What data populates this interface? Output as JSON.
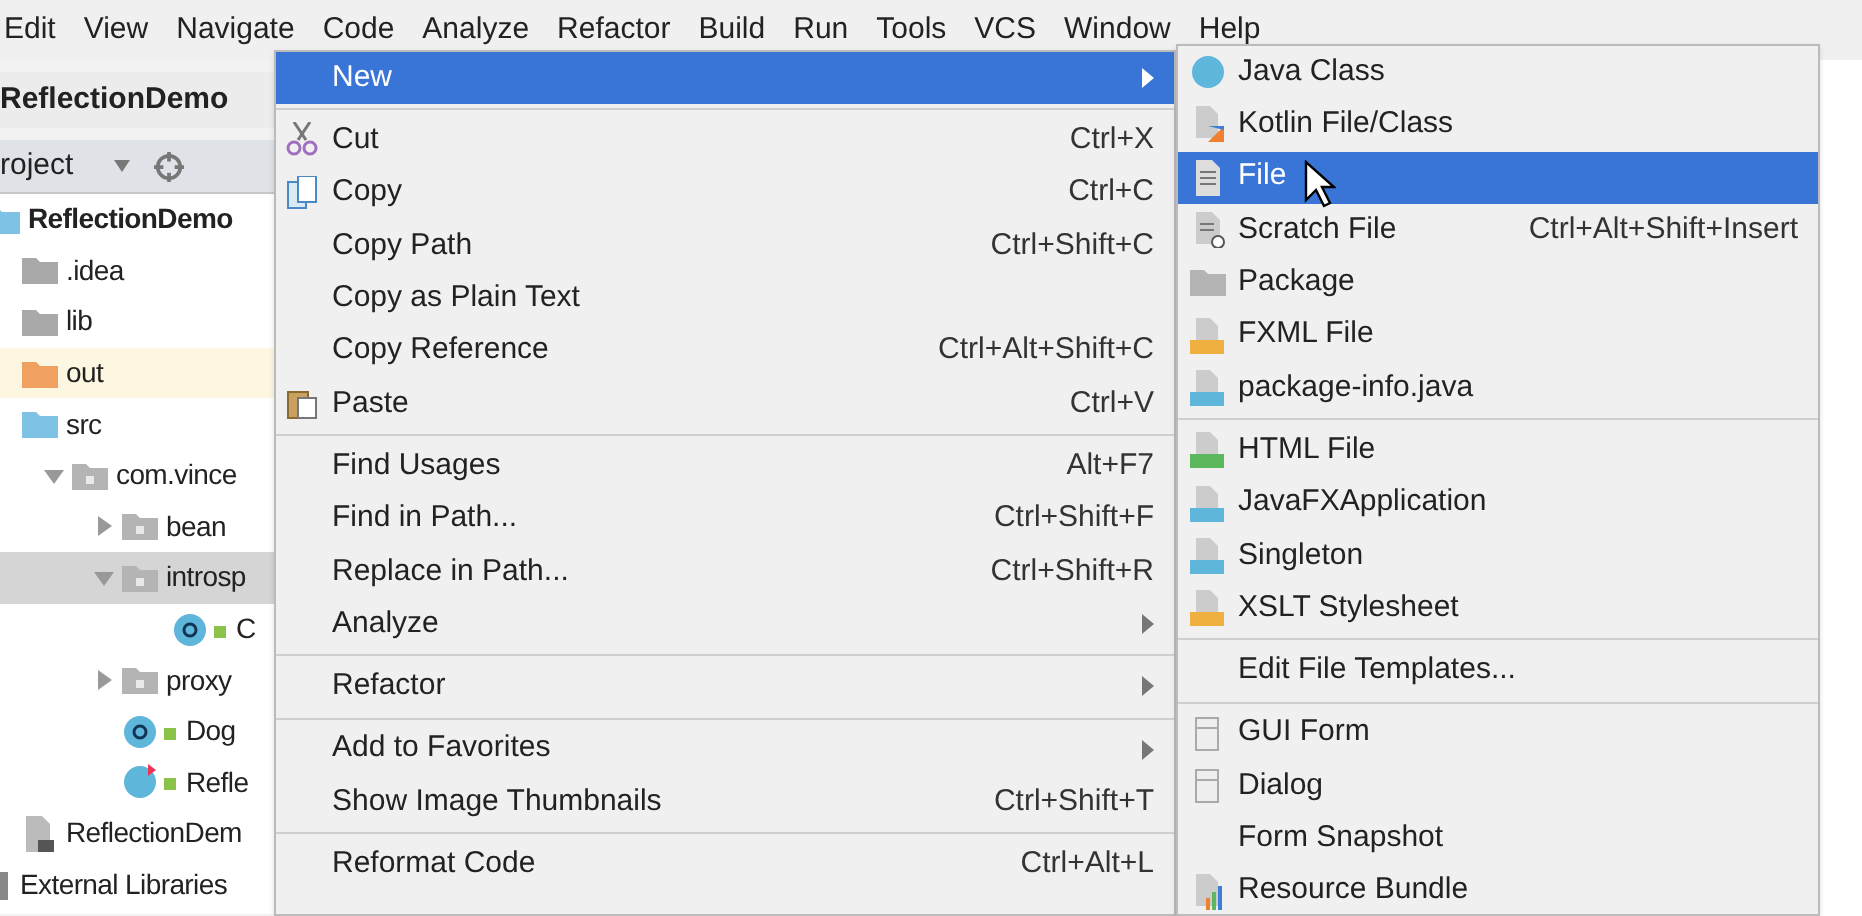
{
  "menu_bar": [
    {
      "label": "Edit"
    },
    {
      "label": "View"
    },
    {
      "label": "Navigate"
    },
    {
      "label": "Code"
    },
    {
      "label": "Analyze"
    },
    {
      "label": "Refactor"
    },
    {
      "label": "Build"
    },
    {
      "label": "Run"
    },
    {
      "label": "Tools"
    },
    {
      "label": "VCS"
    },
    {
      "label": "Window"
    },
    {
      "label": "Help"
    }
  ],
  "breadcrumb": "ReflectionDemo",
  "project_panel": {
    "title": "roject",
    "tree": [
      {
        "label": "ReflectionDemo",
        "kind": "module",
        "children": [
          {
            "label": ".idea",
            "kind": "folder",
            "color": "#a9a9a9"
          },
          {
            "label": "lib",
            "kind": "folder",
            "color": "#a9a9a9"
          },
          {
            "label": "out",
            "kind": "folder",
            "color": "#f0a060",
            "highlighted": true
          },
          {
            "label": "src",
            "kind": "folder",
            "color": "#7ec3e6",
            "children": [
              {
                "label": "com.vince",
                "kind": "package",
                "expanded": true,
                "children": [
                  {
                    "label": "bean",
                    "kind": "package",
                    "expanded": false
                  },
                  {
                    "label": "introsp",
                    "kind": "package",
                    "expanded": true,
                    "selected": true,
                    "children": [
                      {
                        "label": "C",
                        "kind": "class"
                      }
                    ]
                  },
                  {
                    "label": "proxy",
                    "kind": "package",
                    "expanded": false
                  },
                  {
                    "label": "Dog",
                    "kind": "class"
                  },
                  {
                    "label": "Refle",
                    "kind": "runclass"
                  }
                ]
              }
            ]
          },
          {
            "label": "ReflectionDem",
            "kind": "iml"
          }
        ]
      },
      {
        "label": "External Libraries",
        "kind": "library"
      }
    ]
  },
  "context_menu": [
    {
      "kind": "item",
      "label": "New",
      "selected": true,
      "submenu": true
    },
    {
      "kind": "separator"
    },
    {
      "kind": "item",
      "label": "Cut",
      "shortcut": "Ctrl+X",
      "selected": false
    },
    {
      "kind": "item",
      "label": "Copy",
      "shortcut": "Ctrl+C",
      "selected": false
    },
    {
      "kind": "item",
      "label": "Copy Path",
      "shortcut": "Ctrl+Shift+C",
      "selected": false
    },
    {
      "kind": "item",
      "label": "Copy as Plain Text",
      "selected": false
    },
    {
      "kind": "item",
      "label": "Copy Reference",
      "shortcut": "Ctrl+Alt+Shift+C",
      "selected": false
    },
    {
      "kind": "item",
      "label": "Paste",
      "shortcut": "Ctrl+V",
      "selected": false
    },
    {
      "kind": "separator"
    },
    {
      "kind": "item",
      "label": "Find Usages",
      "shortcut": "Alt+F7",
      "selected": false
    },
    {
      "kind": "item",
      "label": "Find in Path...",
      "shortcut": "Ctrl+Shift+F",
      "selected": false
    },
    {
      "kind": "item",
      "label": "Replace in Path...",
      "shortcut": "Ctrl+Shift+R",
      "selected": false
    },
    {
      "kind": "item",
      "label": "Analyze",
      "submenu": true,
      "selected": false
    },
    {
      "kind": "separator"
    },
    {
      "kind": "item",
      "label": "Refactor",
      "submenu": true,
      "selected": false
    },
    {
      "kind": "separator"
    },
    {
      "kind": "item",
      "label": "Add to Favorites",
      "submenu": true,
      "selected": false
    },
    {
      "kind": "item",
      "label": "Show Image Thumbnails",
      "shortcut": "Ctrl+Shift+T",
      "selected": false
    },
    {
      "kind": "separator"
    },
    {
      "kind": "item",
      "label": "Reformat Code",
      "shortcut": "Ctrl+Alt+L",
      "selected": false
    }
  ],
  "new_submenu": [
    {
      "kind": "item",
      "label": "Java Class",
      "selected": false
    },
    {
      "kind": "item",
      "label": "Kotlin File/Class",
      "selected": false
    },
    {
      "kind": "item",
      "label": "File",
      "selected": true
    },
    {
      "kind": "item",
      "label": "Scratch File",
      "shortcut": "Ctrl+Alt+Shift+Insert",
      "selected": false
    },
    {
      "kind": "item",
      "label": "Package",
      "selected": false
    },
    {
      "kind": "item",
      "label": "FXML File",
      "selected": false
    },
    {
      "kind": "item",
      "label": "package-info.java",
      "selected": false
    },
    {
      "kind": "separator"
    },
    {
      "kind": "item",
      "label": "HTML File",
      "selected": false
    },
    {
      "kind": "item",
      "label": "JavaFXApplication",
      "selected": false
    },
    {
      "kind": "item",
      "label": "Singleton",
      "selected": false
    },
    {
      "kind": "item",
      "label": "XSLT Stylesheet",
      "selected": false
    },
    {
      "kind": "separator"
    },
    {
      "kind": "item",
      "label": "Edit File Templates...",
      "selected": false
    },
    {
      "kind": "separator"
    },
    {
      "kind": "item",
      "label": "GUI Form",
      "selected": false
    },
    {
      "kind": "item",
      "label": "Dialog",
      "selected": false
    },
    {
      "kind": "item",
      "label": "Form Snapshot",
      "selected": false
    },
    {
      "kind": "item",
      "label": "Resource Bundle",
      "selected": false
    }
  ]
}
